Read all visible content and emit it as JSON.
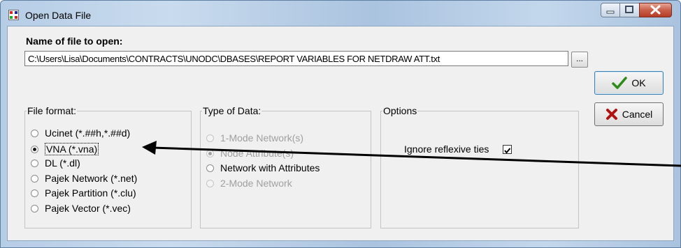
{
  "window": {
    "title": "Open Data File"
  },
  "file": {
    "label": "Name of file to open:",
    "path": "C:\\Users\\Lisa\\Documents\\CONTRACTS\\UNODC\\DBASES\\REPORT VARIABLES FOR NETDRAW ATT.txt",
    "browse_label": "..."
  },
  "buttons": {
    "ok": "OK",
    "cancel": "Cancel"
  },
  "file_format": {
    "legend": "File format:",
    "options": [
      {
        "label": "Ucinet (*.##h,*.##d)",
        "selected": false
      },
      {
        "label": "VNA (*.vna)",
        "selected": true
      },
      {
        "label": "DL (*.dl)",
        "selected": false
      },
      {
        "label": "Pajek Network (*.net)",
        "selected": false
      },
      {
        "label": "Pajek Partition (*.clu)",
        "selected": false
      },
      {
        "label": "Pajek Vector (*.vec)",
        "selected": false
      }
    ]
  },
  "data_type": {
    "legend": "Type of Data:",
    "options": [
      {
        "label": "1-Mode Network(s)",
        "selected": false,
        "enabled": false
      },
      {
        "label": "Node Attribute(s)",
        "selected": true,
        "enabled": false
      },
      {
        "label": "Network with Attributes",
        "selected": false,
        "enabled": true
      },
      {
        "label": "2-Mode Network",
        "selected": false,
        "enabled": false
      }
    ]
  },
  "options": {
    "legend": "Options",
    "ignore_reflexive_label": "Ignore reflexive ties",
    "ignore_reflexive_checked": true
  },
  "colors": {
    "ok_check": "#2e8b1a",
    "cancel_x": "#b01212",
    "close_btn": "#c95f4a"
  }
}
